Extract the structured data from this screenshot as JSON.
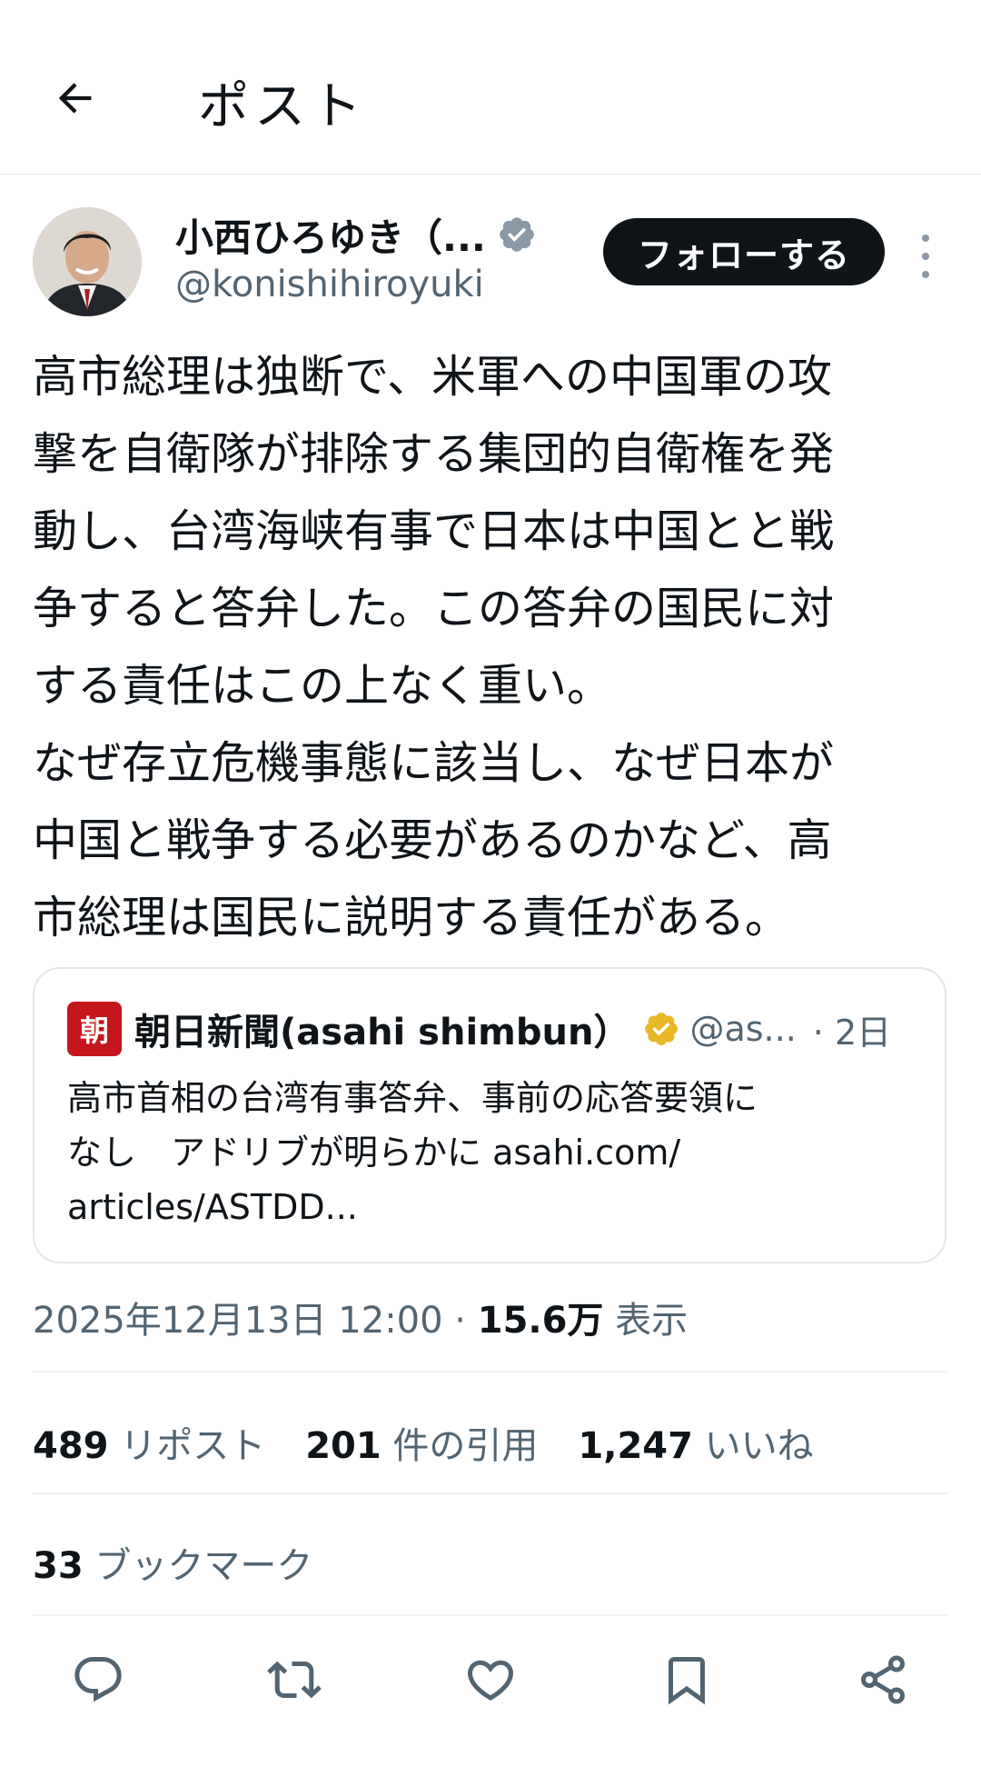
{
  "header": {
    "title": "ポスト",
    "back_icon": "arrow-left-icon"
  },
  "author": {
    "name": "小西ひろゆき（...",
    "handle": "@konishihiroyuki",
    "verified_icon": "verified-badge-icon",
    "follow_label": "フォローする",
    "more_icon": "more-vertical-icon"
  },
  "tweet": {
    "lines": [
      "高市総理は独断で、米軍への中国軍の攻",
      "撃を自衛隊が排除する集団的自衛権を発",
      "動し、台湾海峡有事で日本は中国とと戦",
      "争すると答弁した。この答弁の国民に対",
      "する責任はこの上なく重い。",
      "なぜ存立危機事態に該当し、なぜ日本が",
      "中国と戦争する必要があるのかなど、高",
      "市総理は国民に説明する責任がある。"
    ]
  },
  "quote": {
    "logo_text": "朝",
    "name": "朝日新聞(asahi shimbun）",
    "handle": "@as...",
    "date": "· 2日",
    "text_lines": [
      "高市首相の台湾有事答弁、事前の応答要領に",
      "なし　アドリブが明らかに asahi.com/",
      "articles/ASTDD..."
    ]
  },
  "meta": {
    "timestamp": "2025年12月13日 12:00 · ",
    "views_count": "15.6万",
    "views_label": " 表示"
  },
  "stats": {
    "reposts": {
      "num": "489",
      "label": " リポスト"
    },
    "quotes": {
      "num": "201",
      "label": " 件の引用"
    },
    "likes": {
      "num": "1,247",
      "label": " いいね"
    },
    "bookmarks": {
      "num": "33",
      "label": " ブックマーク"
    }
  },
  "actions": [
    "reply-icon",
    "repost-icon",
    "like-icon",
    "bookmark-icon",
    "share-icon"
  ],
  "colors": {
    "text": "#0f1419",
    "secondary": "#536471",
    "verified_blue": "#8b98a5",
    "gold": "#e8b829",
    "asahi_red": "#c4161c"
  }
}
